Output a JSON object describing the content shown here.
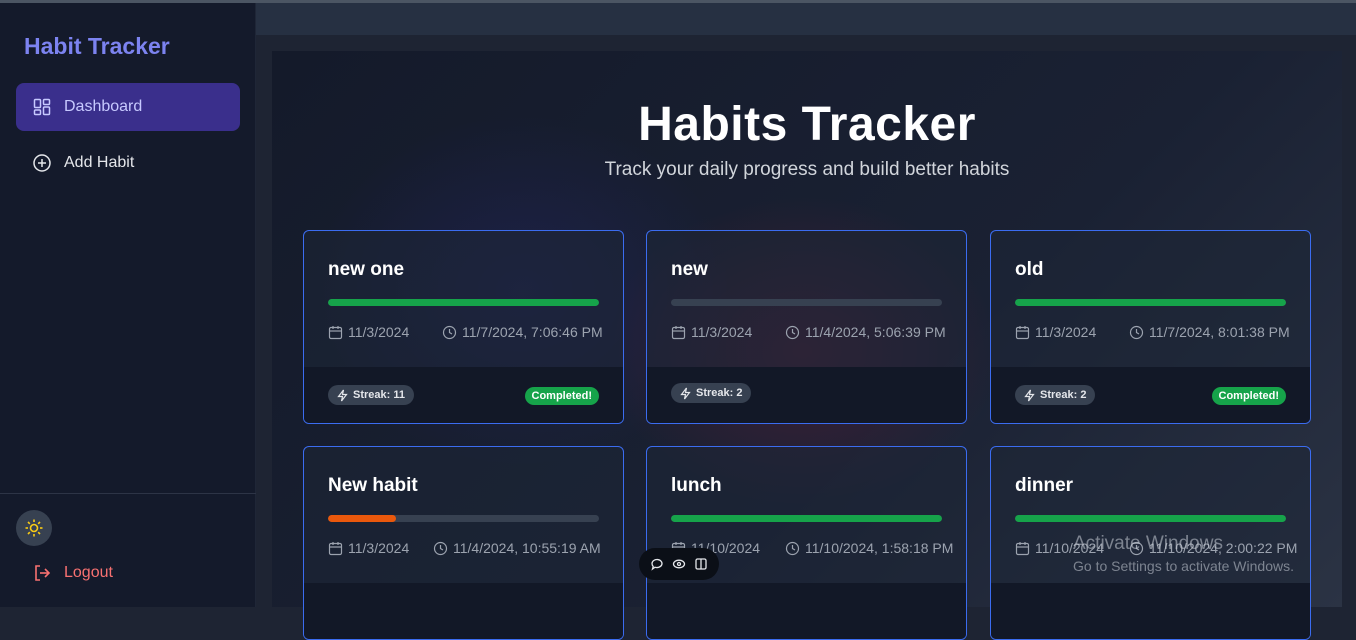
{
  "sidebar": {
    "brand": "Habit Tracker",
    "items": [
      {
        "label": "Dashboard",
        "icon": "dashboard-grid-icon",
        "active": true
      },
      {
        "label": "Add Habit",
        "icon": "plus-circle-icon",
        "active": false
      }
    ],
    "theme_icon": "sun-icon",
    "logout_label": "Logout"
  },
  "main": {
    "title": "Habits Tracker",
    "subtitle": "Track your daily progress and build better habits"
  },
  "habits": [
    {
      "name": "new one",
      "progress": 1.0,
      "bar_color": "#16a34a",
      "start": "11/3/2024",
      "last": "11/7/2024, 7:06:46 PM",
      "streak": "Streak: 11",
      "status": "Completed!"
    },
    {
      "name": "new",
      "progress": 0.0,
      "bar_color": "#16a34a",
      "start": "11/3/2024",
      "last": "11/4/2024, 5:06:39 PM",
      "streak": "Streak: 2",
      "status": ""
    },
    {
      "name": "old",
      "progress": 1.0,
      "bar_color": "#16a34a",
      "start": "11/3/2024",
      "last": "11/7/2024, 8:01:38 PM",
      "streak": "Streak: 2",
      "status": "Completed!"
    },
    {
      "name": "New habit",
      "progress": 0.25,
      "bar_color": "#ea580c",
      "start": "11/3/2024",
      "last": "11/4/2024, 10:55:19 AM",
      "streak": "",
      "status": ""
    },
    {
      "name": "lunch",
      "progress": 1.0,
      "bar_color": "#16a34a",
      "start": "11/10/2024",
      "last": "11/10/2024, 1:58:18 PM",
      "streak": "",
      "status": ""
    },
    {
      "name": "dinner",
      "progress": 1.0,
      "bar_color": "#16a34a",
      "start": "11/10/2024",
      "last": "11/10/2024, 2:00:22 PM",
      "streak": "",
      "status": ""
    }
  ],
  "overlay": {
    "watermark_title": "Activate Windows",
    "watermark_sub": "Go to Settings to activate Windows."
  },
  "colors": {
    "accent": "#3a2f8c",
    "brand": "#7c83f0",
    "success": "#16a34a",
    "warning": "#ea580c",
    "danger": "#f87171"
  }
}
